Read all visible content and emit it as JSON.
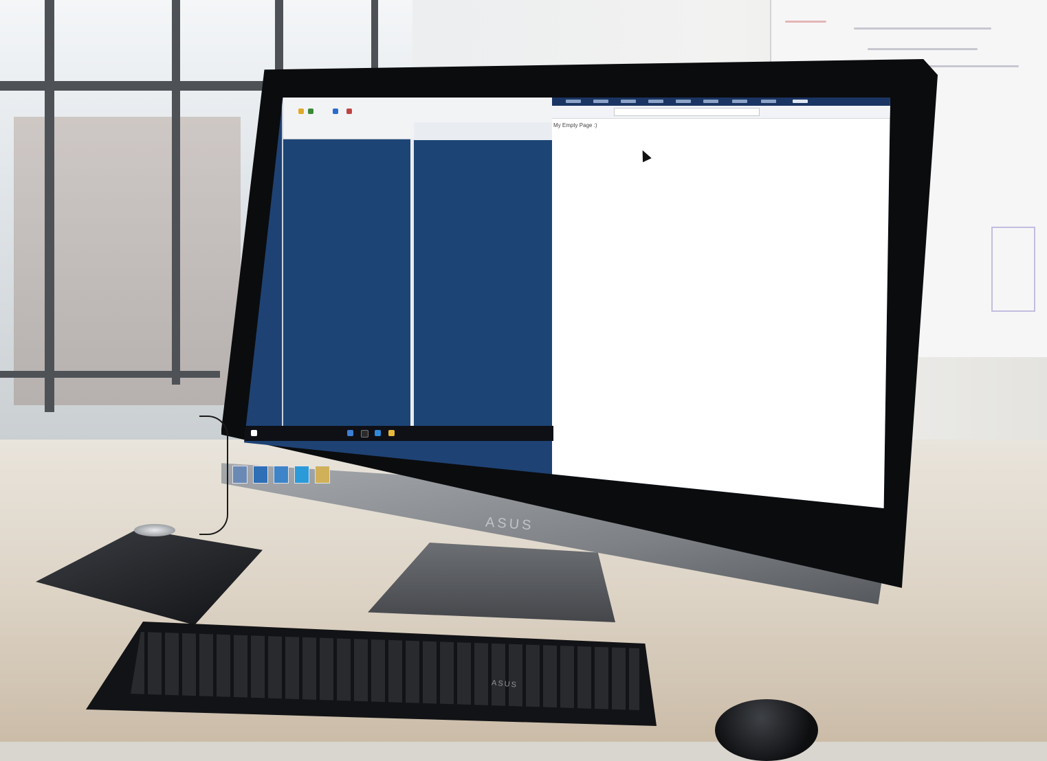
{
  "browser": {
    "page_heading": "My Empty Page :)"
  },
  "monitor": {
    "brand": "ASUS"
  },
  "keyboard": {
    "brand": "ASUS"
  },
  "colors": {
    "desktop_blue": "#1e4274",
    "bezel": "#0b0c0e",
    "browser_bg": "#ffffff",
    "taskbar": "#0e1016"
  },
  "icons": {
    "cursor": "arrow-cursor-icon",
    "toolbar": [
      "folder-icon",
      "copy-icon",
      "refresh-icon",
      "settings-icon"
    ],
    "taskbar": [
      "start-icon",
      "browser-icon",
      "terminal-icon",
      "mail-icon",
      "explorer-icon"
    ]
  }
}
